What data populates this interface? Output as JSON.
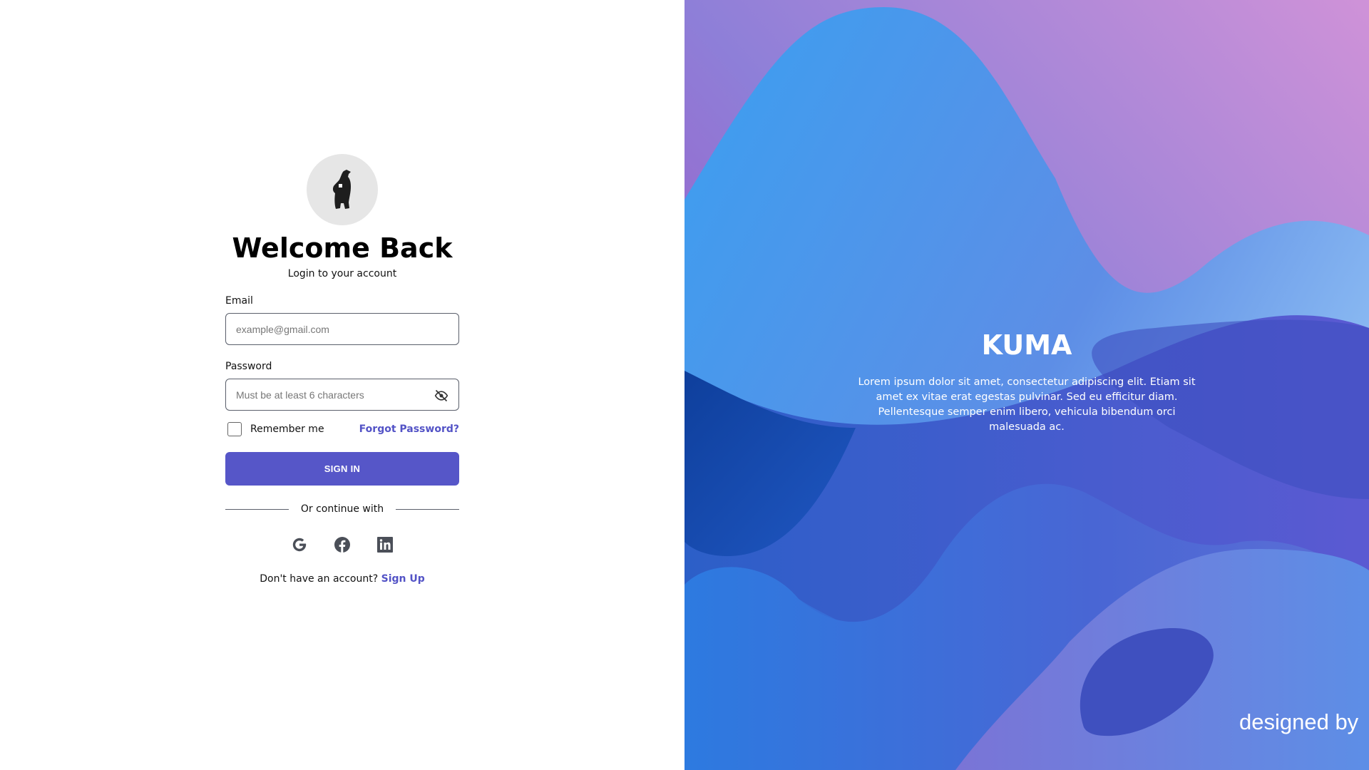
{
  "login": {
    "title": "Welcome Back",
    "subtitle": "Login to your account",
    "email_label": "Email",
    "email_placeholder": "example@gmail.com",
    "email_value": "",
    "password_label": "Password",
    "password_placeholder": "Must be at least 6 characters",
    "password_value": "",
    "remember_label": "Remember me",
    "remember_checked": false,
    "forgot_label": "Forgot Password?",
    "signin_label": "SIGN IN",
    "divider_text": "Or continue with",
    "social": [
      "google-icon",
      "facebook-icon",
      "linkedin-icon"
    ],
    "no_account_text": "Don't have an account?",
    "signup_label": "Sign Up"
  },
  "hero": {
    "title": "KUMA",
    "description": "Lorem ipsum dolor sit amet, consectetur adipiscing elit. Etiam sit amet ex vitae erat egestas pulvinar. Sed eu efficitur diam. Pellentesque semper enim libero, vehicula bibendum orci malesuada ac.",
    "designed_by": "designed by"
  },
  "colors": {
    "accent": "#5656c8",
    "link": "#5353c6"
  }
}
